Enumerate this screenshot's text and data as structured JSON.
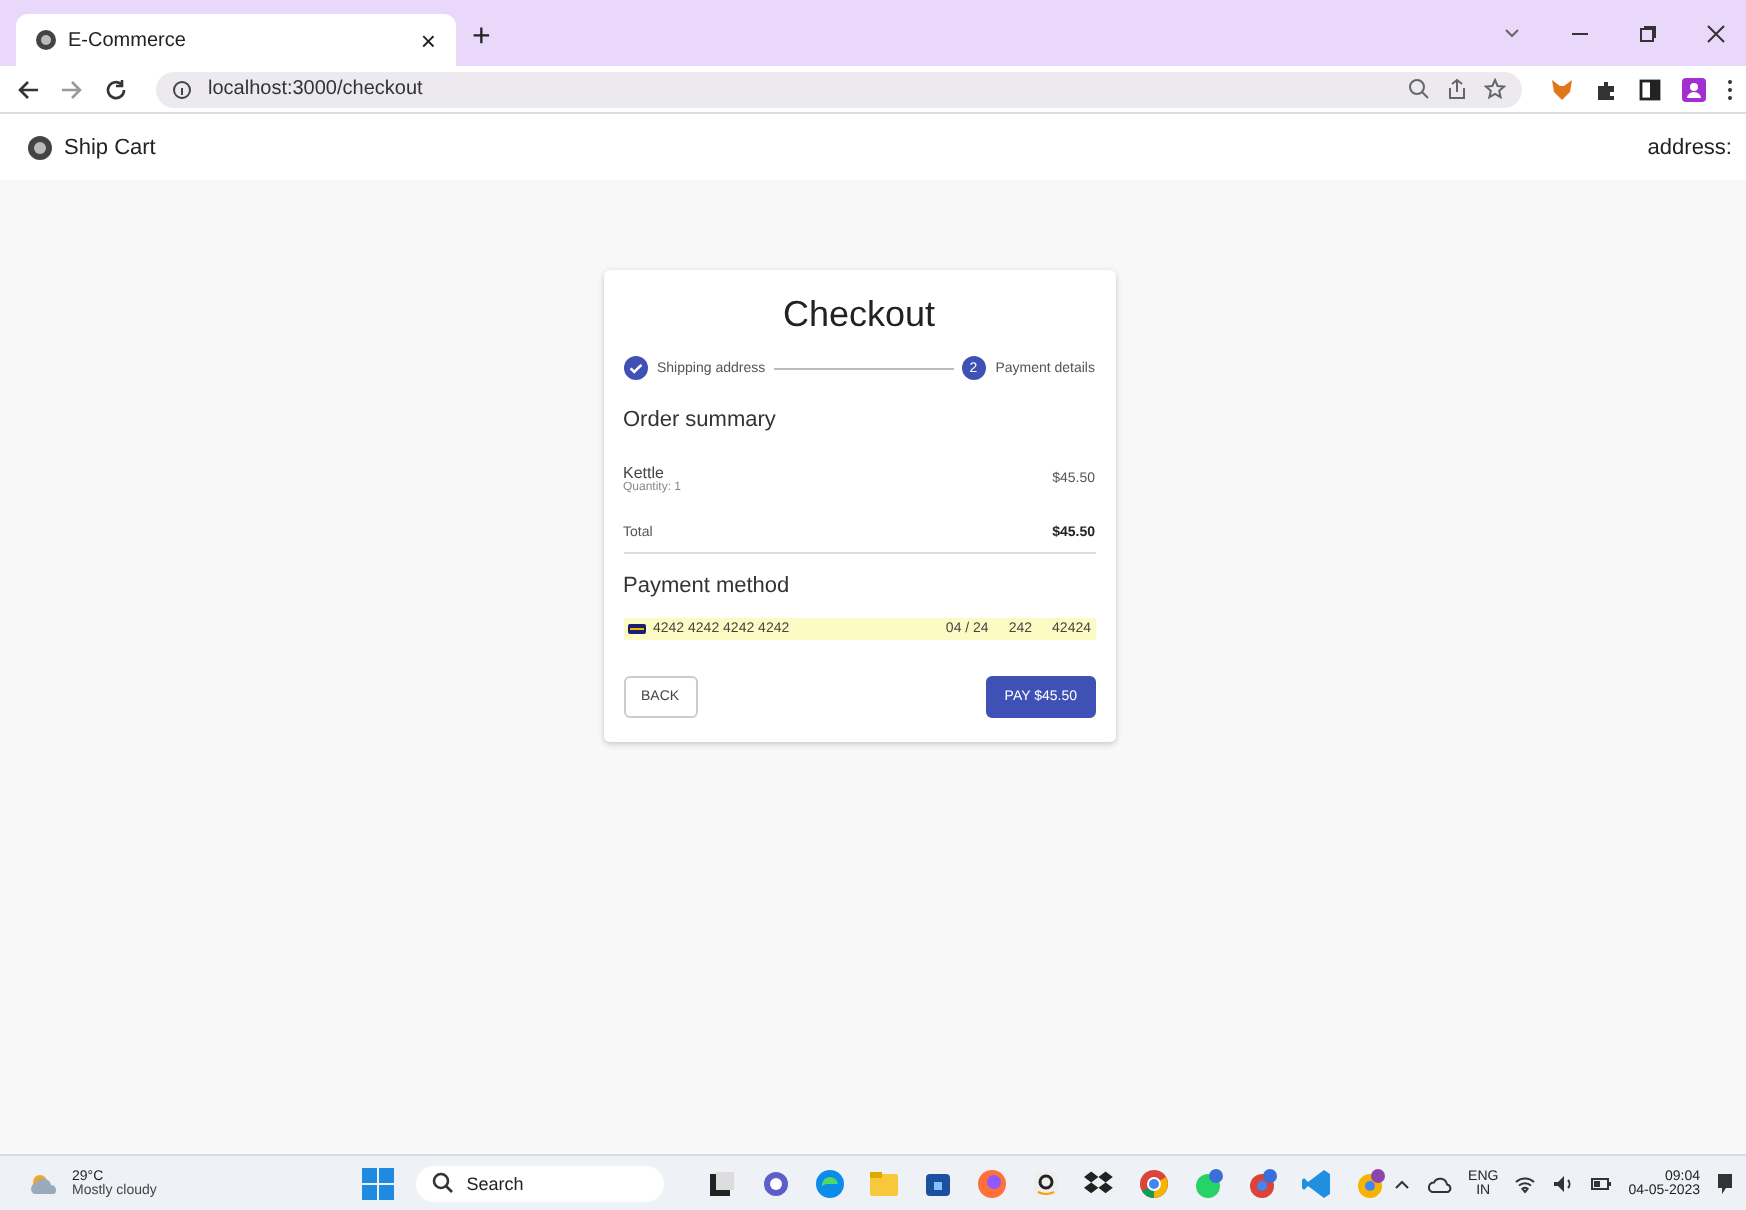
{
  "browser": {
    "tab": {
      "title": "E-Commerce",
      "close": "×"
    },
    "new_tab": "+",
    "url": "localhost:3000/checkout"
  },
  "app_bar": {
    "title": "Ship Cart",
    "address_label": "address:"
  },
  "checkout": {
    "title": "Checkout",
    "steps": [
      {
        "label": "Shipping address",
        "completed": true
      },
      {
        "label": "Payment details",
        "number": "2",
        "completed": false
      }
    ],
    "order_summary": {
      "heading": "Order summary",
      "items": [
        {
          "name": "Kettle",
          "quantity": "Quantity: 1",
          "price": "$45.50"
        }
      ],
      "total_label": "Total",
      "total": "$45.50"
    },
    "payment": {
      "heading": "Payment method",
      "card_number": "4242 4242 4242 4242",
      "expiry": "04 / 24",
      "cvc": "242",
      "zip": "42424",
      "autofilled": true
    },
    "buttons": [
      {
        "kind": "outlined",
        "label": "BACK"
      },
      {
        "kind": "contained",
        "label": "PAY $45.50"
      }
    ]
  },
  "taskbar": {
    "weather": {
      "temperature": "29°C",
      "condition": "Mostly cloudy"
    },
    "search_placeholder": "Search",
    "language": "ENG",
    "region": "IN",
    "time": "09:04",
    "date": "04-05-2023"
  }
}
